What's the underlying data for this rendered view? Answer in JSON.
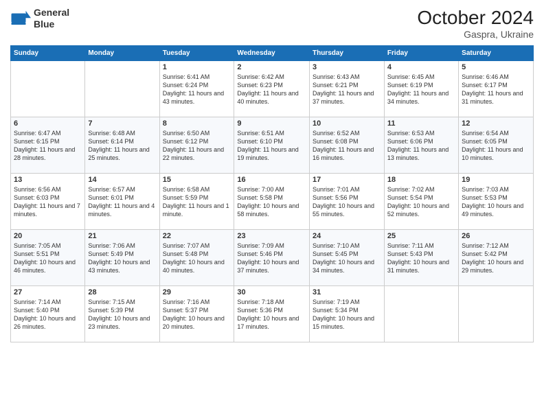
{
  "header": {
    "logo_line1": "General",
    "logo_line2": "Blue",
    "month": "October 2024",
    "location": "Gaspra, Ukraine"
  },
  "days_of_week": [
    "Sunday",
    "Monday",
    "Tuesday",
    "Wednesday",
    "Thursday",
    "Friday",
    "Saturday"
  ],
  "weeks": [
    [
      {
        "day": "",
        "content": ""
      },
      {
        "day": "",
        "content": ""
      },
      {
        "day": "1",
        "content": "Sunrise: 6:41 AM\nSunset: 6:24 PM\nDaylight: 11 hours and 43 minutes."
      },
      {
        "day": "2",
        "content": "Sunrise: 6:42 AM\nSunset: 6:23 PM\nDaylight: 11 hours and 40 minutes."
      },
      {
        "day": "3",
        "content": "Sunrise: 6:43 AM\nSunset: 6:21 PM\nDaylight: 11 hours and 37 minutes."
      },
      {
        "day": "4",
        "content": "Sunrise: 6:45 AM\nSunset: 6:19 PM\nDaylight: 11 hours and 34 minutes."
      },
      {
        "day": "5",
        "content": "Sunrise: 6:46 AM\nSunset: 6:17 PM\nDaylight: 11 hours and 31 minutes."
      }
    ],
    [
      {
        "day": "6",
        "content": "Sunrise: 6:47 AM\nSunset: 6:15 PM\nDaylight: 11 hours and 28 minutes."
      },
      {
        "day": "7",
        "content": "Sunrise: 6:48 AM\nSunset: 6:14 PM\nDaylight: 11 hours and 25 minutes."
      },
      {
        "day": "8",
        "content": "Sunrise: 6:50 AM\nSunset: 6:12 PM\nDaylight: 11 hours and 22 minutes."
      },
      {
        "day": "9",
        "content": "Sunrise: 6:51 AM\nSunset: 6:10 PM\nDaylight: 11 hours and 19 minutes."
      },
      {
        "day": "10",
        "content": "Sunrise: 6:52 AM\nSunset: 6:08 PM\nDaylight: 11 hours and 16 minutes."
      },
      {
        "day": "11",
        "content": "Sunrise: 6:53 AM\nSunset: 6:06 PM\nDaylight: 11 hours and 13 minutes."
      },
      {
        "day": "12",
        "content": "Sunrise: 6:54 AM\nSunset: 6:05 PM\nDaylight: 11 hours and 10 minutes."
      }
    ],
    [
      {
        "day": "13",
        "content": "Sunrise: 6:56 AM\nSunset: 6:03 PM\nDaylight: 11 hours and 7 minutes."
      },
      {
        "day": "14",
        "content": "Sunrise: 6:57 AM\nSunset: 6:01 PM\nDaylight: 11 hours and 4 minutes."
      },
      {
        "day": "15",
        "content": "Sunrise: 6:58 AM\nSunset: 5:59 PM\nDaylight: 11 hours and 1 minute."
      },
      {
        "day": "16",
        "content": "Sunrise: 7:00 AM\nSunset: 5:58 PM\nDaylight: 10 hours and 58 minutes."
      },
      {
        "day": "17",
        "content": "Sunrise: 7:01 AM\nSunset: 5:56 PM\nDaylight: 10 hours and 55 minutes."
      },
      {
        "day": "18",
        "content": "Sunrise: 7:02 AM\nSunset: 5:54 PM\nDaylight: 10 hours and 52 minutes."
      },
      {
        "day": "19",
        "content": "Sunrise: 7:03 AM\nSunset: 5:53 PM\nDaylight: 10 hours and 49 minutes."
      }
    ],
    [
      {
        "day": "20",
        "content": "Sunrise: 7:05 AM\nSunset: 5:51 PM\nDaylight: 10 hours and 46 minutes."
      },
      {
        "day": "21",
        "content": "Sunrise: 7:06 AM\nSunset: 5:49 PM\nDaylight: 10 hours and 43 minutes."
      },
      {
        "day": "22",
        "content": "Sunrise: 7:07 AM\nSunset: 5:48 PM\nDaylight: 10 hours and 40 minutes."
      },
      {
        "day": "23",
        "content": "Sunrise: 7:09 AM\nSunset: 5:46 PM\nDaylight: 10 hours and 37 minutes."
      },
      {
        "day": "24",
        "content": "Sunrise: 7:10 AM\nSunset: 5:45 PM\nDaylight: 10 hours and 34 minutes."
      },
      {
        "day": "25",
        "content": "Sunrise: 7:11 AM\nSunset: 5:43 PM\nDaylight: 10 hours and 31 minutes."
      },
      {
        "day": "26",
        "content": "Sunrise: 7:12 AM\nSunset: 5:42 PM\nDaylight: 10 hours and 29 minutes."
      }
    ],
    [
      {
        "day": "27",
        "content": "Sunrise: 7:14 AM\nSunset: 5:40 PM\nDaylight: 10 hours and 26 minutes."
      },
      {
        "day": "28",
        "content": "Sunrise: 7:15 AM\nSunset: 5:39 PM\nDaylight: 10 hours and 23 minutes."
      },
      {
        "day": "29",
        "content": "Sunrise: 7:16 AM\nSunset: 5:37 PM\nDaylight: 10 hours and 20 minutes."
      },
      {
        "day": "30",
        "content": "Sunrise: 7:18 AM\nSunset: 5:36 PM\nDaylight: 10 hours and 17 minutes."
      },
      {
        "day": "31",
        "content": "Sunrise: 7:19 AM\nSunset: 5:34 PM\nDaylight: 10 hours and 15 minutes."
      },
      {
        "day": "",
        "content": ""
      },
      {
        "day": "",
        "content": ""
      }
    ]
  ]
}
